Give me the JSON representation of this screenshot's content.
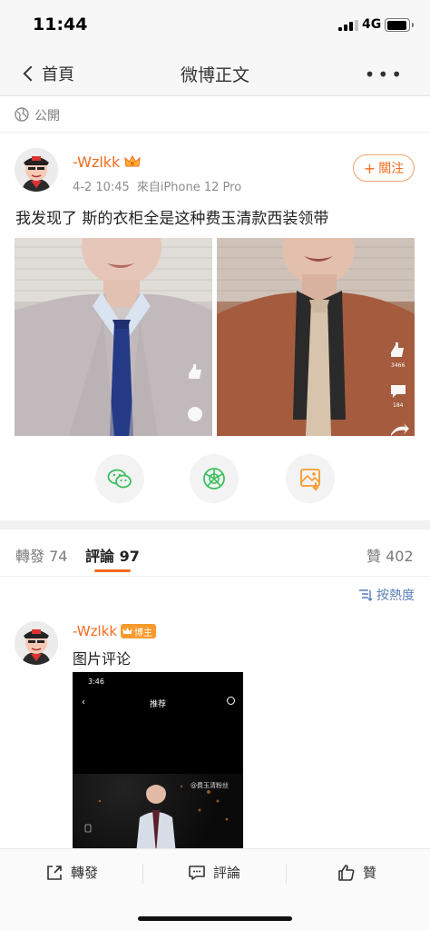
{
  "status_bar": {
    "time": "11:44",
    "network": "4G",
    "battery_level": 0.85,
    "signal_bars": 3
  },
  "nav": {
    "back_label": "首頁",
    "title": "微博正文",
    "more_icon": "more-icon"
  },
  "visibility": {
    "icon": "globe-icon",
    "label": "公開"
  },
  "post": {
    "user_name": "-Wzlkk",
    "meta_time": "4-2 10:45",
    "meta_source": "來自iPhone 12 Pro",
    "follow_label": "關注",
    "text": "我发现了 斯的衣柜全是这种费玉清款西装领带",
    "photo2_likes": "3466",
    "photo2_comments": "184"
  },
  "share_buttons": [
    "wechat-icon",
    "moments-icon",
    "save-image-icon"
  ],
  "tabs": {
    "repost_label": "轉發",
    "repost_count": "74",
    "comment_label": "評論",
    "comment_count": "97",
    "like_label": "贊",
    "like_count": "402"
  },
  "sort_label": "按熱度",
  "comment": {
    "user_name": "-Wzlkk",
    "badge": "博主",
    "text": "图片评论",
    "image": {
      "time": "3:46",
      "title": "推荐",
      "watermark": "@费玉清粉丝"
    }
  },
  "bottom_bar": {
    "repost": "轉發",
    "comment": "評論",
    "like": "贊"
  },
  "colors": {
    "accent": "#f26b1d",
    "link": "#5a7fb8",
    "wechat": "#3bbf5e",
    "badge": "#f79a2c"
  }
}
